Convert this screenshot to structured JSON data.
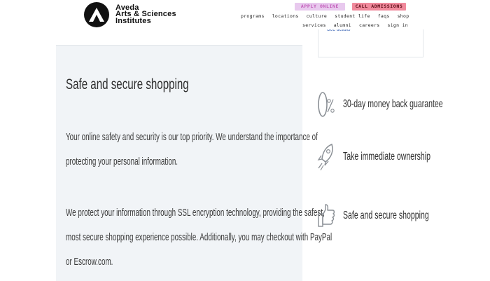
{
  "header": {
    "logo_lines": [
      "Aveda",
      "Arts & Sciences",
      "Institutes"
    ],
    "apply_label": "APPLY ONLINE",
    "call_label": "CALL ADMISSIONS",
    "nav_row1": [
      "programs",
      "locations",
      "culture",
      "student life",
      "faqs",
      "shop"
    ],
    "nav_row2": [
      "services",
      "alumni",
      "careers",
      "sign in"
    ]
  },
  "main": {
    "title": "Safe and secure shopping",
    "para1_lines": [
      "Your online safety and security is our top priority. We understand the importance of",
      "protecting your personal information."
    ],
    "para2_lines": [
      "We protect your information through SSL encryption technology, providing the safest,",
      "most secure shopping experience possible. Additionally, you may checkout with PayPal",
      "or Escrow.com."
    ]
  },
  "side": {
    "link_text": "See details",
    "features": [
      {
        "label": "30-day money back guarantee",
        "icon": "zero-percent-icon"
      },
      {
        "label": "Take immediate ownership",
        "icon": "rocket-icon"
      },
      {
        "label": "Safe and secure shopping",
        "icon": "thumbs-up-icon"
      }
    ]
  },
  "colors": {
    "card_bg": "#f1f4f7",
    "apply_bg": "#e8c9ee",
    "call_bg": "#f08a9c",
    "link": "#3c66b5"
  }
}
